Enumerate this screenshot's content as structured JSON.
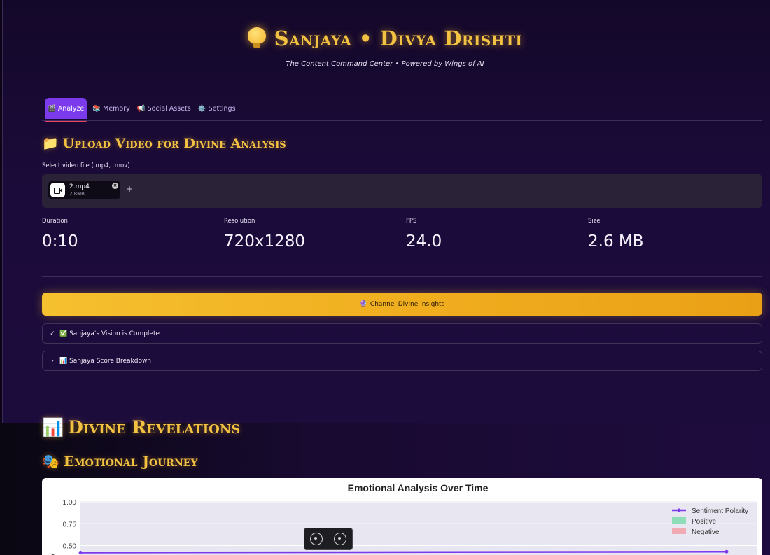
{
  "app": {
    "title": "Sanjaya • Divya Drishti",
    "title_icon": "lightbulb-icon",
    "subtitle": "The Content Command Center • Powered by Wings of AI"
  },
  "tabs": [
    {
      "icon": "🎬",
      "label": "Analyze",
      "active": true
    },
    {
      "icon": "📚",
      "label": "Memory",
      "active": false
    },
    {
      "icon": "📢",
      "label": "Social Assets",
      "active": false
    },
    {
      "icon": "⚙️",
      "label": "Settings",
      "active": false
    }
  ],
  "upload": {
    "icon": "📁",
    "title": "Upload Video for Divine Analysis",
    "file_label": "Select video file (.mp4, .mov)",
    "file": {
      "name": "2.mp4",
      "size": "2.8MB"
    },
    "add_label": "+"
  },
  "metrics": [
    {
      "label": "Duration",
      "value": "0:10"
    },
    {
      "label": "Resolution",
      "value": "720x1280"
    },
    {
      "label": "FPS",
      "value": "24.0"
    },
    {
      "label": "Size",
      "value": "2.6 MB"
    }
  ],
  "action": {
    "icon": "🔮",
    "label": "Channel Divine Insights"
  },
  "expanders": [
    {
      "chevron": "✓",
      "label": "✅ Sanjaya's Vision is Complete"
    },
    {
      "chevron": "›",
      "label": "📊 Sanjaya Score Breakdown"
    }
  ],
  "revelations": {
    "icon": "📊",
    "title": "Divine Revelations"
  },
  "journey": {
    "icon": "🎭",
    "title": "Emotional Journey"
  },
  "colors": {
    "accent_gold": "#f4c242",
    "active_tab": "#7c3aed",
    "polarity_line": "#7c3aed",
    "positive": "#8fdcb8",
    "negative": "#f0aab3"
  },
  "chart_data": {
    "type": "line",
    "title": "Emotional Analysis Over Time",
    "ylabel": "y",
    "y_ticks": [
      "1.00",
      "0.75",
      "0.50"
    ],
    "ylim": [
      0.4,
      1.0
    ],
    "legend": [
      "Sentiment Polarity",
      "Positive",
      "Negative"
    ],
    "legend_position": "top-right",
    "series": [
      {
        "name": "Sentiment Polarity",
        "x": [
          0.0,
          1.0
        ],
        "y": [
          0.42,
          0.43
        ]
      }
    ]
  }
}
